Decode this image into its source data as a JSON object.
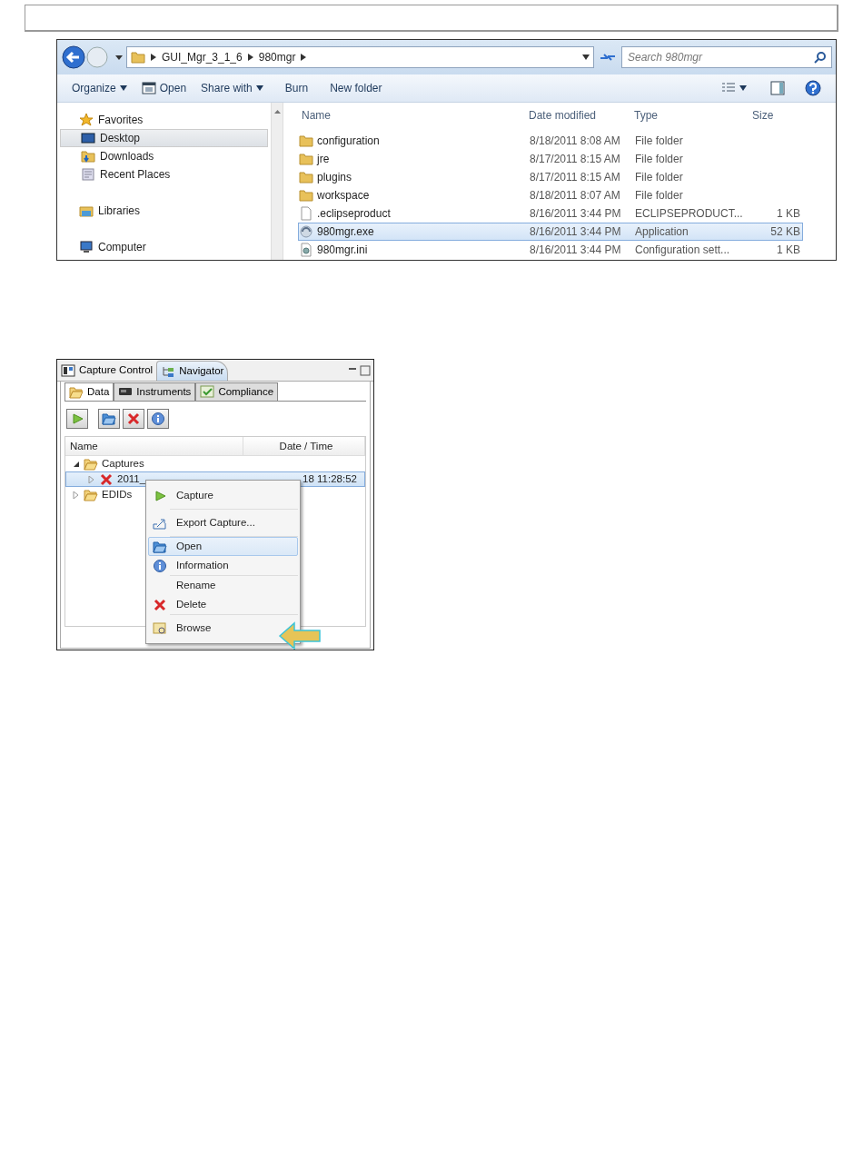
{
  "explorer": {
    "breadcrumb": [
      "GUI_Mgr_3_1_6",
      "980mgr"
    ],
    "search": {
      "placeholder": "Search 980mgr"
    },
    "toolbar": [
      {
        "label": "Organize",
        "kind": "menu"
      },
      {
        "label": "Open",
        "kind": "icon"
      },
      {
        "label": "Share with",
        "kind": "menu"
      },
      {
        "label": "Burn",
        "kind": "plain"
      },
      {
        "label": "New folder",
        "kind": "plain"
      }
    ],
    "nav": [
      {
        "label": "Favorites",
        "kind": "star",
        "selected": false,
        "items": [
          {
            "label": "Desktop",
            "kind": "desktop",
            "selected": true
          },
          {
            "label": "Downloads",
            "kind": "downloads",
            "selected": false
          },
          {
            "label": "Recent Places",
            "kind": "recent",
            "selected": false
          }
        ]
      },
      {
        "label": "Libraries",
        "kind": "libraries",
        "selected": false
      },
      {
        "label": "Computer",
        "kind": "computer",
        "selected": false
      }
    ],
    "columns": [
      "Name",
      "Date modified",
      "Type",
      "Size"
    ],
    "files": [
      {
        "name": "configuration",
        "date": "8/18/2011 8:08 AM",
        "type": "File folder",
        "kind": "folder",
        "selected": false
      },
      {
        "name": "jre",
        "date": "8/17/2011 8:15 AM",
        "type": "File folder",
        "kind": "folder",
        "selected": false
      },
      {
        "name": "plugins",
        "date": "8/17/2011 8:15 AM",
        "type": "File folder",
        "kind": "folder",
        "selected": false
      },
      {
        "name": "workspace",
        "date": "8/18/2011 8:07 AM",
        "type": "File folder",
        "kind": "folder",
        "selected": false
      },
      {
        "name": ".eclipseproduct",
        "date": "8/16/2011 3:44 PM",
        "type": "ECLIPSEPRODUCT...",
        "size": "1 KB",
        "kind": "file",
        "selected": false
      },
      {
        "name": "980mgr.exe",
        "date": "8/16/2011 3:44 PM",
        "type": "Application",
        "size": "52 KB",
        "kind": "exe",
        "selected": true
      },
      {
        "name": "980mgr.ini",
        "date": "8/16/2011 3:44 PM",
        "type": "Configuration sett...",
        "size": "1 KB",
        "kind": "ini",
        "selected": false
      }
    ]
  },
  "navigator": {
    "view_tabs": [
      {
        "label": "Capture Control",
        "selected": false
      },
      {
        "label": "Navigator",
        "selected": true
      }
    ],
    "sub_tabs": [
      {
        "label": "Data",
        "kind": "data",
        "selected": true
      },
      {
        "label": "Instruments",
        "kind": "instruments",
        "selected": false
      },
      {
        "label": "Compliance",
        "kind": "compliance",
        "selected": false
      }
    ],
    "toolbar": [
      {
        "kind": "run"
      },
      {
        "kind": "open"
      },
      {
        "kind": "delete"
      },
      {
        "kind": "info"
      }
    ],
    "columns": [
      "Name",
      "Date / Time"
    ],
    "tree": [
      {
        "label": "Captures",
        "expanded": true,
        "children": [
          {
            "name": "2011_",
            "date": "18 11:28:52",
            "selected": true
          }
        ]
      },
      {
        "label": "EDIDs",
        "expanded": false
      }
    ],
    "context_menu": [
      [
        {
          "label": "Capture",
          "kind": "run",
          "selected": false
        }
      ],
      [
        {
          "label": "Export Capture...",
          "kind": "export",
          "selected": false
        }
      ],
      [
        {
          "label": "Open",
          "kind": "open",
          "selected": true
        },
        {
          "label": "Information",
          "kind": "info",
          "selected": false
        }
      ],
      [
        {
          "label": "Rename",
          "kind": "none",
          "selected": false
        },
        {
          "label": "Delete",
          "kind": "delete",
          "selected": false
        }
      ],
      [
        {
          "label": "Browse",
          "kind": "browse",
          "selected": false
        }
      ]
    ]
  }
}
